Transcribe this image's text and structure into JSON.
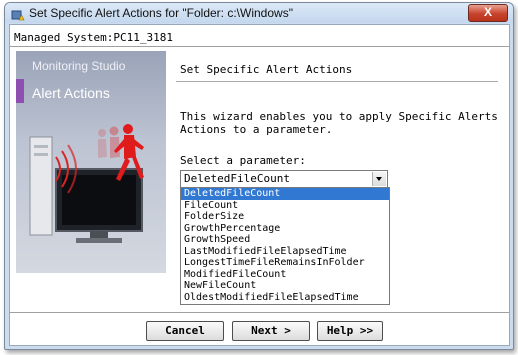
{
  "window": {
    "title": "Set Specific Alert Actions for \"Folder: c:\\Windows\"",
    "close_label": "X"
  },
  "managed_system": "Managed System:PC11_3181",
  "side_panel": {
    "brand": "Monitoring Studio",
    "title": "Alert Actions"
  },
  "content": {
    "heading": "Set Specific Alert Actions",
    "description": "This wizard enables you to apply Specific Alerts Actions to a parameter.",
    "param_label": "Select a parameter:",
    "selected_value": "DeletedFileCount",
    "options": [
      "DeletedFileCount",
      "FileCount",
      "FolderSize",
      "GrowthPercentage",
      "GrowthSpeed",
      "LastModifiedFileElapsedTime",
      "LongestTimeFileRemainsInFolder",
      "ModifiedFileCount",
      "NewFileCount",
      "OldestModifiedFileElapsedTime"
    ]
  },
  "buttons": {
    "cancel": "Cancel",
    "next": "Next >",
    "help": "Help >>"
  },
  "colors": {
    "selection": "#3178d2",
    "accent": "#8e4fb0",
    "close": "#c8432b"
  }
}
